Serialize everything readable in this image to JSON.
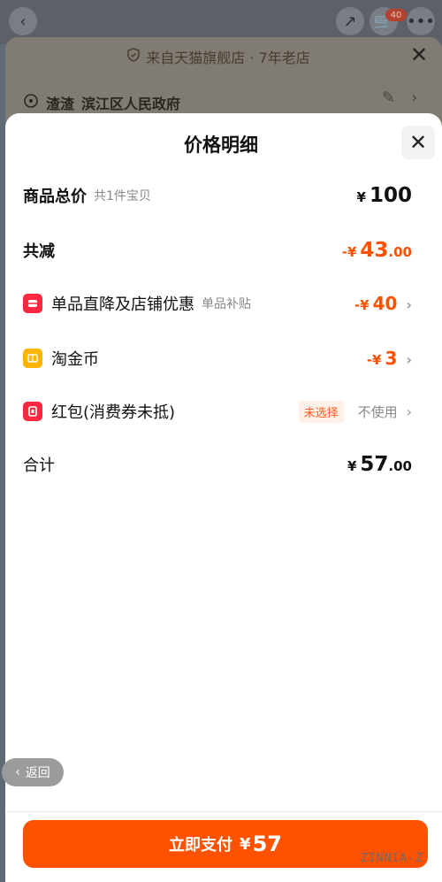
{
  "background": {
    "store_info": "来自天猫旗舰店 · 7年老店",
    "address_name": "渣渣",
    "address": "滨江区人民政府",
    "cart_count": "40"
  },
  "sheet": {
    "title": "价格明细",
    "rows": [
      {
        "label": "商品总价",
        "sub": "共1件宝贝",
        "value_prefix": "¥",
        "value_main": "100",
        "value_dec": ""
      },
      {
        "label": "共减",
        "value_prefix": "-¥",
        "value_main": "43",
        "value_dec": ".00"
      },
      {
        "label": "单品直降及店铺优惠",
        "sub": "单品补贴",
        "value_prefix": "-¥",
        "value_main": "40",
        "value_dec": ""
      },
      {
        "label": "淘金币",
        "value_prefix": "-¥",
        "value_main": "3",
        "value_dec": ""
      },
      {
        "label": "红包(消费券未抵)",
        "tag": "未选择",
        "value_text": "不使用"
      },
      {
        "label": "合计",
        "value_prefix": "¥",
        "value_main": "57",
        "value_dec": ".00"
      }
    ]
  },
  "back_label": "返回",
  "pay_button": {
    "label": "立即支付",
    "yen": "¥",
    "amount": "57"
  },
  "watermark": "ZINNIA-Z",
  "colors": {
    "accent": "#ff5000",
    "tag_bg": "#fff1e8"
  }
}
